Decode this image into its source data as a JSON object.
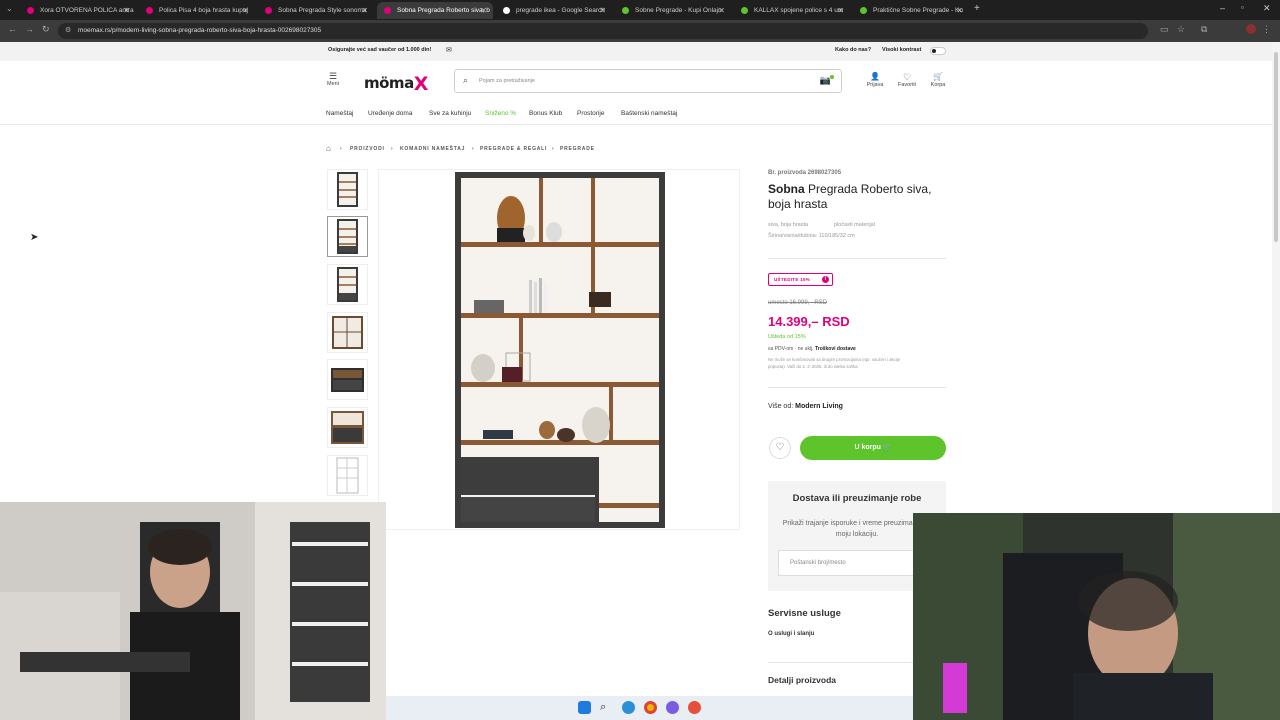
{
  "browser": {
    "tabs": [
      {
        "title": "Xora OTVORENA POLICA antra",
        "color": "#e2007a"
      },
      {
        "title": "Polica Pisa 4 boja hrasta kupuj",
        "color": "#e2007a"
      },
      {
        "title": "Sobna Pregrada Style sonoma",
        "color": "#e2007a"
      },
      {
        "title": "Sobna Pregrada Roberto siva, b",
        "color": "#e2007a"
      },
      {
        "title": "pregrade ikea - Google Search",
        "color": "#ffffff"
      },
      {
        "title": "Sobne Pregrade - Kupi Onlajn",
        "color": "#5ec42c"
      },
      {
        "title": "KALLAX spojene police s 4 um",
        "color": "#5ec42c"
      },
      {
        "title": "Praktične Sobne Pregrade - Ku",
        "color": "#5ec42c"
      }
    ],
    "url": "moemax.rs/p/modern-living-sobna-pregrada-roberto-siva-boja-hrasta-002698027305"
  },
  "promo": {
    "text": "Osigurajte već sad vaučer od 1.000 din!",
    "help": "Kako do nas?",
    "contrast": "Visoki kontrast"
  },
  "header": {
    "menu_label": "Meni",
    "logo_text": "mömax",
    "search_placeholder": "Pojam za pretraživanje",
    "login": "Prijava",
    "favorites": "Favoriti",
    "cart": "Korpa"
  },
  "nav": [
    "Nameštaj",
    "Uređenje doma",
    "Sve za kuhinju",
    "Sniženo %",
    "Bonus Klub",
    "Prostorije",
    "Baštenski nameštaj"
  ],
  "breadcrumb": [
    "PROIZVODI",
    "KOMADNI NAMEŠTAJ",
    "PREGRADE & REGALI",
    "PREGRADE"
  ],
  "product": {
    "number": "Br. proizvoda 2698027305",
    "title_bold": "Sobna",
    "title_rest": "Pregrada Roberto siva,",
    "title_line2": "boja hrasta",
    "color": "siva, boja hrasta",
    "material": "pločasti materijal",
    "dimensions": "Širina/visina/dubina: 110/185/32 cm",
    "badge": "UŠTEDITE 15%",
    "old_price": "umesto 16.999,– RSD",
    "price": "14.399,– RSD",
    "savings": "Ušteda od 15%",
    "tax_prefix": "sa PDV-om · ne uklj.",
    "tax_link": "Troškovi dostave",
    "fine_print_1": "Ne može se kombinovati sa drugim promocijama (npr. vaučeri i akcije",
    "fine_print_2": "popusta). Važi do 2. 3. 2025. ili do isteka zaliha.",
    "brand_prefix": "Više od:",
    "brand": "Modern Living",
    "cart_button": "U korpu"
  },
  "delivery": {
    "title": "Dostava ili preuzimanje robe",
    "desc": "Prikaži trajanje isporuke i vreme preuzimanja za moju lokaciju.",
    "placeholder": "Poštanski broj/mesto"
  },
  "services": {
    "title": "Servisne usluge",
    "link": "O uslugi i slanju"
  },
  "details": "Detalji proizvoda",
  "colors": {
    "accent": "#e2007a",
    "green": "#5ec42c"
  }
}
